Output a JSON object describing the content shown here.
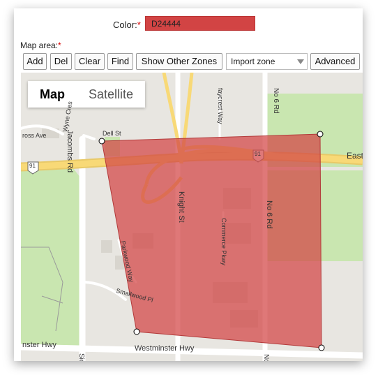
{
  "form": {
    "color_label": "Color:",
    "required_mark": "*",
    "color_value": "D24444",
    "color_hex": "#D24444",
    "map_area_label": "Map area:"
  },
  "toolbar": {
    "add": "Add",
    "del": "Del",
    "clear": "Clear",
    "find": "Find",
    "show_other_zones": "Show Other Zones",
    "import_zone": "Import zone",
    "advanced": "Advanced"
  },
  "map": {
    "type_map": "Map",
    "type_satellite": "Satellite",
    "zone_fill_color": "#D24444",
    "labels": {
      "jacombs_rd": "Jacombs Rd",
      "wyne_cres": "Wyne Cres",
      "cross_ave": "ross Ave",
      "dell_st": "Dell St",
      "faycrest_way": "faycrest Way",
      "no6_rd_top": "No 6 Rd",
      "no6_rd_mid": "No 6 Rd",
      "knight_st": "Knight St",
      "commerce_pkwy": "Commerce Pkwy",
      "parkwood_way": "Parkwood Way",
      "smallwood_pl": "Smallwood Pl",
      "westminster_hwy_left": "nster Hwy",
      "westminster_hwy": "Westminster Hwy",
      "east": "East",
      "route91_left": "91",
      "route91_mid": "91",
      "sic": "Sic",
      "no_bottom": "No"
    }
  }
}
